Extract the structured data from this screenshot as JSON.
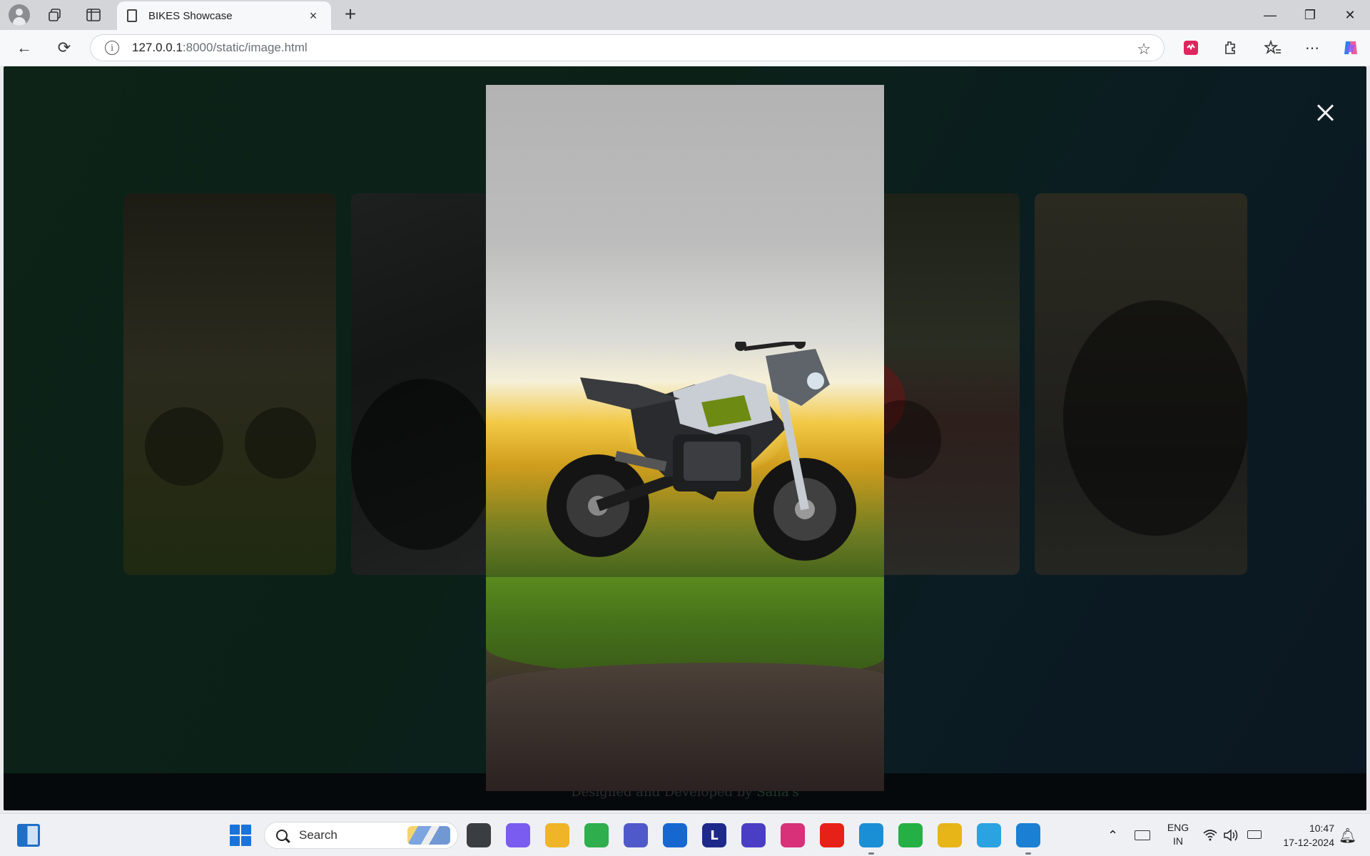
{
  "browser": {
    "tab_title": "BIKES Showcase",
    "tab_close": "×",
    "new_tab": "+",
    "url_host": "127.0.0.1",
    "url_path": ":8000/static/image.html",
    "window_controls": {
      "minimize": "—",
      "restore": "❐",
      "close": "✕"
    },
    "toolbar_icons": [
      "pdf-reader-icon",
      "extensions-icon",
      "favorites-icon",
      "more-icon",
      "copilot-icon"
    ]
  },
  "page": {
    "background_colors": [
      "#0d2317",
      "#0b1722"
    ],
    "gallery_cards": [
      "bike-card-1",
      "bike-card-2",
      "bike-card-4",
      "bike-card-5"
    ],
    "lightbox_open": true,
    "lightbox_subject": "motorcycle-at-sunset",
    "footer": {
      "prefix": "Designed and Developed by ",
      "author": "Sana's"
    }
  },
  "taskbar": {
    "search_placeholder": "Search",
    "apps": [
      {
        "name": "file-explorer-dark",
        "label": "",
        "color": "#3a3d42"
      },
      {
        "name": "copilot",
        "label": "",
        "color": "#7a5cf0"
      },
      {
        "name": "file-explorer",
        "label": "",
        "color": "#f0b429"
      },
      {
        "name": "ring-app",
        "label": "",
        "color": "#2fae4e"
      },
      {
        "name": "teams",
        "label": "",
        "color": "#5059c9"
      },
      {
        "name": "store",
        "label": "",
        "color": "#1767d1"
      },
      {
        "name": "l-app",
        "label": "L",
        "color": "#1e2a8a"
      },
      {
        "name": "a-app",
        "label": "",
        "color": "#4a3fc4"
      },
      {
        "name": "instagram",
        "label": "",
        "color": "#d9307a"
      },
      {
        "name": "youtube",
        "label": "",
        "color": "#e62117"
      },
      {
        "name": "edge",
        "label": "",
        "color": "#1b8fd6"
      },
      {
        "name": "whatsapp",
        "label": "",
        "color": "#25b045"
      },
      {
        "name": "chrome",
        "label": "",
        "color": "#e8b518"
      },
      {
        "name": "telegram",
        "label": "",
        "color": "#2aa3e0"
      },
      {
        "name": "vscode",
        "label": "",
        "color": "#1b7fd4"
      }
    ],
    "lang_top": "ENG",
    "lang_bottom": "IN",
    "time": "10:47",
    "date": "17-12-2024"
  }
}
